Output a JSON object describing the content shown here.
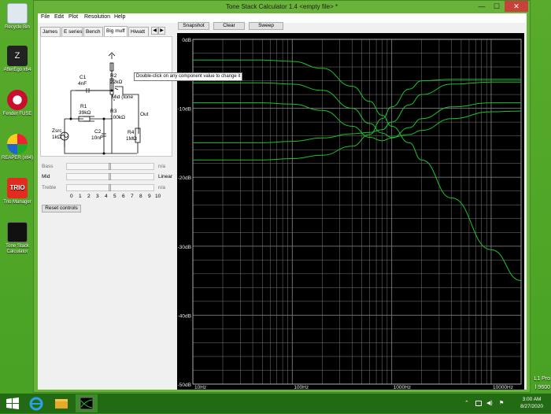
{
  "window": {
    "title": "Tone Stack Calculator 1.4 <empty file> *",
    "minimize_glyph": "—",
    "maximize_glyph": "☐",
    "close_glyph": "✕"
  },
  "menu": [
    "File",
    "Edit",
    "Plot",
    "Resolution",
    "Help"
  ],
  "tabs": [
    "James",
    "E series",
    "Bench",
    "Big muff",
    "Hiwatt"
  ],
  "tab_arrows": [
    "◀",
    "▶"
  ],
  "active_tab": "Big muff",
  "toolbar": {
    "snapshot": "Snapshot",
    "clear": "Clear",
    "sweep": "Sweep"
  },
  "schematic": {
    "c1": "C1",
    "c1_val": "4nF",
    "r2": "R2",
    "r2_val": "22kΩ",
    "r1": "R1",
    "r1_val": "39kΩ",
    "r3": "R3",
    "r3_val": "100kΩ",
    "mid": "Mid (tone",
    "out": "Out",
    "zsrc": "Zsrc",
    "zsrc_val": "1kΩ",
    "c2": "C2",
    "c2_val": "10nF",
    "r4": "R4",
    "r4_val": "1MΩ"
  },
  "tooltip": "Double-click on any component value to change it",
  "controls": [
    {
      "label": "Bass",
      "value": "n/a",
      "active": false,
      "position": 0.5
    },
    {
      "label": "Mid",
      "value": "Linear",
      "active": true,
      "position": 0.5
    },
    {
      "label": "Treble",
      "value": "n/a",
      "active": false,
      "position": 0.5
    }
  ],
  "scale": [
    "0",
    "1",
    "2",
    "3",
    "4",
    "5",
    "6",
    "7",
    "8",
    "9",
    "10"
  ],
  "reset_label": "Reset controls",
  "chart_data": {
    "type": "line",
    "x_scale": "log",
    "xlim": [
      10,
      20000
    ],
    "ylim": [
      -50,
      0
    ],
    "x_tick_labels": [
      "10Hz",
      "100Hz",
      "1000Hz",
      "10000Hz"
    ],
    "y_tick_labels": [
      "0dB",
      "-10dB",
      "-20dB",
      "-30dB",
      "-40dB",
      "-50dB"
    ],
    "y_ticks": [
      0,
      -10,
      -20,
      -30,
      -40,
      -50
    ],
    "x_ticks": [
      10,
      100,
      1000,
      10000
    ],
    "grid": true,
    "background": "#000000",
    "grid_color": "#7a7a7a",
    "line_color": "#19c42a",
    "series": [
      {
        "x": [
          10,
          50,
          100,
          200,
          400,
          600,
          800,
          1000,
          1500,
          2000,
          4000,
          10000,
          20000
        ],
        "y": [
          -17.5,
          -17.5,
          -17.3,
          -16.8,
          -15.5,
          -13.8,
          -11.5,
          -9.8,
          -7.2,
          -6.0,
          -5.8,
          -5.8,
          -5.8
        ]
      },
      {
        "x": [
          10,
          50,
          100,
          200,
          400,
          600,
          800,
          1000,
          1500,
          2000,
          4000,
          10000,
          20000
        ],
        "y": [
          -15.0,
          -15.0,
          -14.8,
          -14.3,
          -13.7,
          -13.5,
          -13.1,
          -12.0,
          -9.5,
          -8.0,
          -6.5,
          -6.2,
          -6.2
        ]
      },
      {
        "x": [
          10,
          50,
          100,
          200,
          400,
          600,
          800,
          1000,
          1500,
          2000,
          4000,
          10000,
          20000
        ],
        "y": [
          -9.2,
          -9.2,
          -9.4,
          -10.3,
          -12.6,
          -14.2,
          -14.7,
          -14.3,
          -12.8,
          -11.5,
          -9.8,
          -9.2,
          -9.2
        ]
      },
      {
        "x": [
          10,
          50,
          100,
          200,
          400,
          600,
          800,
          1000,
          1500,
          2000,
          4000,
          10000,
          20000
        ],
        "y": [
          -6.3,
          -6.3,
          -6.5,
          -7.4,
          -10.0,
          -12.2,
          -13.6,
          -14.2,
          -13.8,
          -13.2,
          -11.5,
          -10.5,
          -10.4
        ]
      },
      {
        "x": [
          10,
          50,
          100,
          200,
          400,
          600,
          800,
          1000,
          1500,
          2000,
          4000,
          10000,
          20000
        ],
        "y": [
          -3.0,
          -3.0,
          -3.2,
          -4.2,
          -6.8,
          -9.0,
          -11.0,
          -12.6,
          -15.0,
          -17.5,
          -23.0,
          -30.5,
          -35.0
        ]
      }
    ]
  },
  "desktop": {
    "icons": [
      "Recycle Bin",
      "AfterEgo x64",
      "Fender FUSE",
      "REAPER (x64)",
      "Trio Manager",
      "Tone Stack Calculator"
    ],
    "tray_edition": "L1 Pro",
    "tray_build": "l 9600",
    "clock_time": "3:00 AM",
    "clock_date": "8/27/2020"
  }
}
